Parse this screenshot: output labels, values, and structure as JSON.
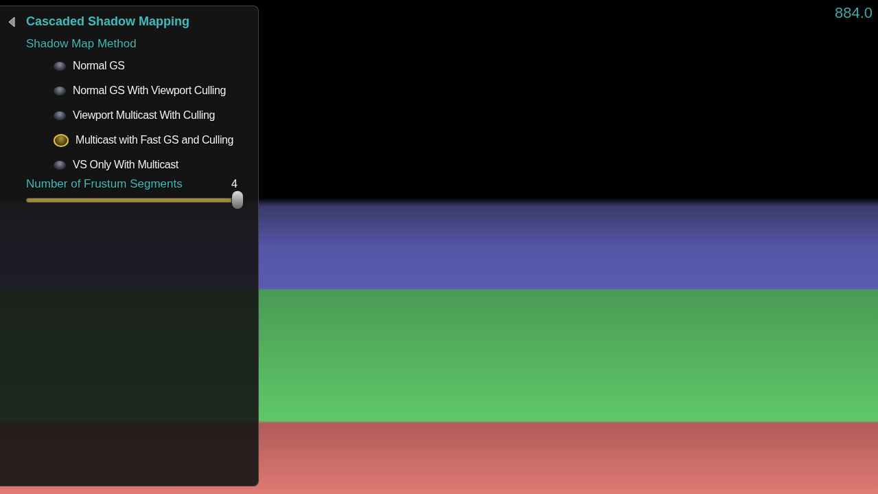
{
  "panel": {
    "title": "Cascaded Shadow Mapping",
    "section_label": "Shadow Map Method",
    "methods": [
      {
        "label": "Normal GS",
        "selected": false
      },
      {
        "label": "Normal GS With Viewport Culling",
        "selected": false
      },
      {
        "label": "Viewport Multicast With Culling",
        "selected": false
      },
      {
        "label": "Multicast with Fast GS and Culling",
        "selected": true
      },
      {
        "label": "VS Only With Multicast",
        "selected": false
      }
    ],
    "slider": {
      "label": "Number of Frustum Segments",
      "value": "4",
      "level": 1.0
    }
  },
  "frame_counter": "884.0"
}
